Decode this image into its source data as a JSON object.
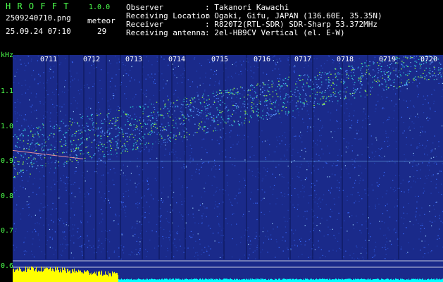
{
  "app": {
    "name": "H R O F F T",
    "version": "1.0.0",
    "filename": "2509240710.png",
    "datetime": "25.09.24 07:10",
    "meteor_label": "meteor",
    "meteor_count": "29"
  },
  "info": {
    "rows": [
      {
        "label": "Observer",
        "value": ": Takanori Kawachi"
      },
      {
        "label": "Receiving Location",
        "value": ": Ogaki, Gifu, JAPAN (136.60E, 35.35N)"
      },
      {
        "label": "Receiver",
        "value": ": R820T2(RTL-SDR) SDR-Sharp 53.372MHz"
      },
      {
        "label": "Receiving antenna",
        "value": ": 2el-HB9CV Vertical (el. E-W)"
      }
    ]
  },
  "spectrogram": {
    "y_unit": "kHz",
    "y_ticks": [
      "1.1",
      "1.0",
      "0.9",
      "0.8",
      "0.7",
      "0.6"
    ],
    "x_ticks": [
      "0711",
      "0712",
      "0713",
      "0714",
      "0715",
      "0716",
      "0717",
      "0718",
      "0719",
      "0720"
    ],
    "colors": {
      "background": "#1a2a8a",
      "noise": "#3a6cff",
      "signal": "#9bff3c",
      "bar_yellow": "#ffff00",
      "bar_cyan": "#00ffff"
    }
  }
}
